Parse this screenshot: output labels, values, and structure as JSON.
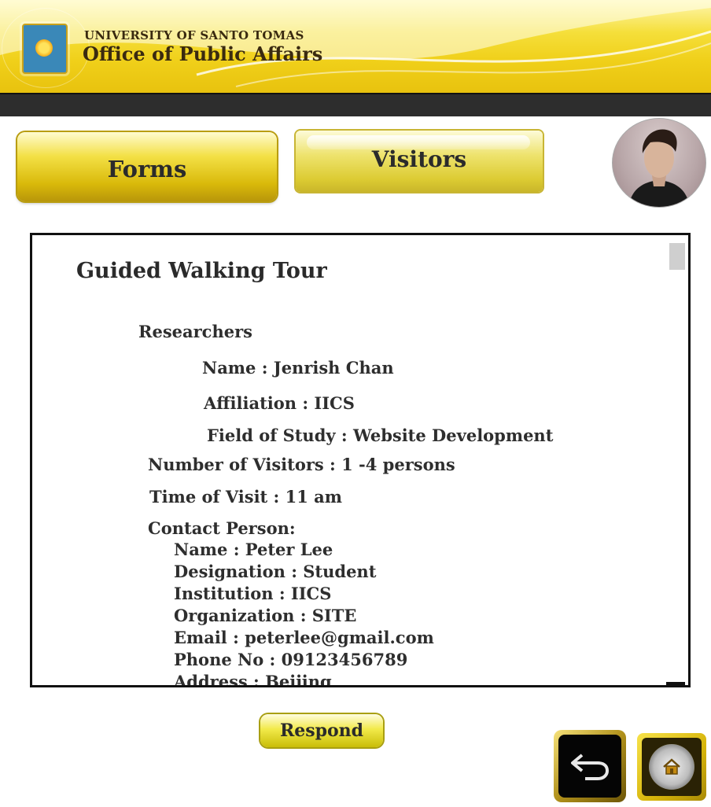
{
  "header": {
    "university": "UNIVERSITY OF SANTO TOMAS",
    "office": "Office of Public Affairs"
  },
  "tabs": {
    "forms": "Forms",
    "visitors": "Visitors"
  },
  "panel": {
    "title": "Guided Walking Tour",
    "category": "Researchers",
    "name": "Name : Jenrish Chan",
    "affiliation": "Affiliation : IICS",
    "field": "Field of Study : Website Development",
    "visitors": "Number of Visitors : 1 -4 persons",
    "time": "Time of Visit : 11 am",
    "contact_heading": "Contact Person:",
    "contact": {
      "name": "Name : Peter Lee",
      "designation": "Designation : Student",
      "institution": "Institution : IICS",
      "organization": "Organization : SITE",
      "email": "Email : peterlee@gmail.com",
      "phone": "Phone No :  09123456789",
      "address": "Address : Beijing"
    }
  },
  "buttons": {
    "respond": "Respond"
  },
  "icons": {
    "back": "back-arrow-icon",
    "home": "home-icon"
  },
  "colors": {
    "accent": "#f0d01a",
    "bar": "#2d2d2d"
  }
}
